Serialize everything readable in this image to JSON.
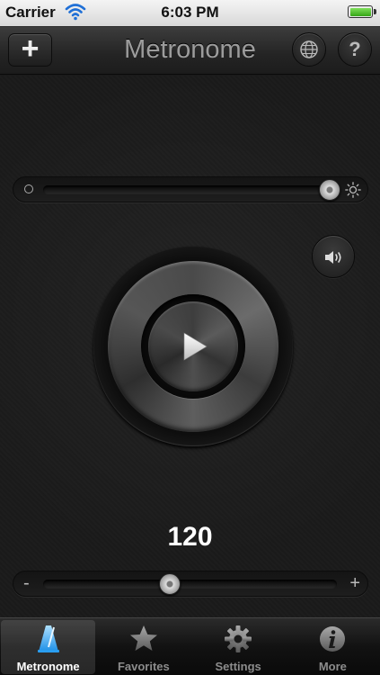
{
  "status_bar": {
    "carrier": "Carrier",
    "time": "6:03 PM",
    "icons": [
      "wifi-icon",
      "battery-icon"
    ]
  },
  "nav_bar": {
    "title": "Metronome",
    "add_label": "+",
    "help_label": "?",
    "icons": [
      "plus-icon",
      "globe-icon",
      "question-icon"
    ]
  },
  "brightness_slider": {
    "value": 0.97,
    "icons": [
      "dim-circle-icon",
      "sun-icon"
    ]
  },
  "sound_button": {
    "icon": "speaker-icon"
  },
  "player": {
    "icon": "play-icon"
  },
  "tempo": {
    "bpm": "120",
    "slider_value": 0.43,
    "minus_label": "-",
    "plus_label": "+"
  },
  "tab_bar": {
    "active": "Metronome",
    "tabs": [
      {
        "label": "Metronome",
        "icon": "metronome-icon"
      },
      {
        "label": "Favorites",
        "icon": "star-icon"
      },
      {
        "label": "Settings",
        "icon": "gear-icon"
      },
      {
        "label": "More",
        "icon": "info-icon"
      }
    ]
  },
  "colors": {
    "background": "#1a1a1a",
    "active_tab_icon": "#5fb8ff",
    "inactive_tab": "#8c8c8c"
  }
}
